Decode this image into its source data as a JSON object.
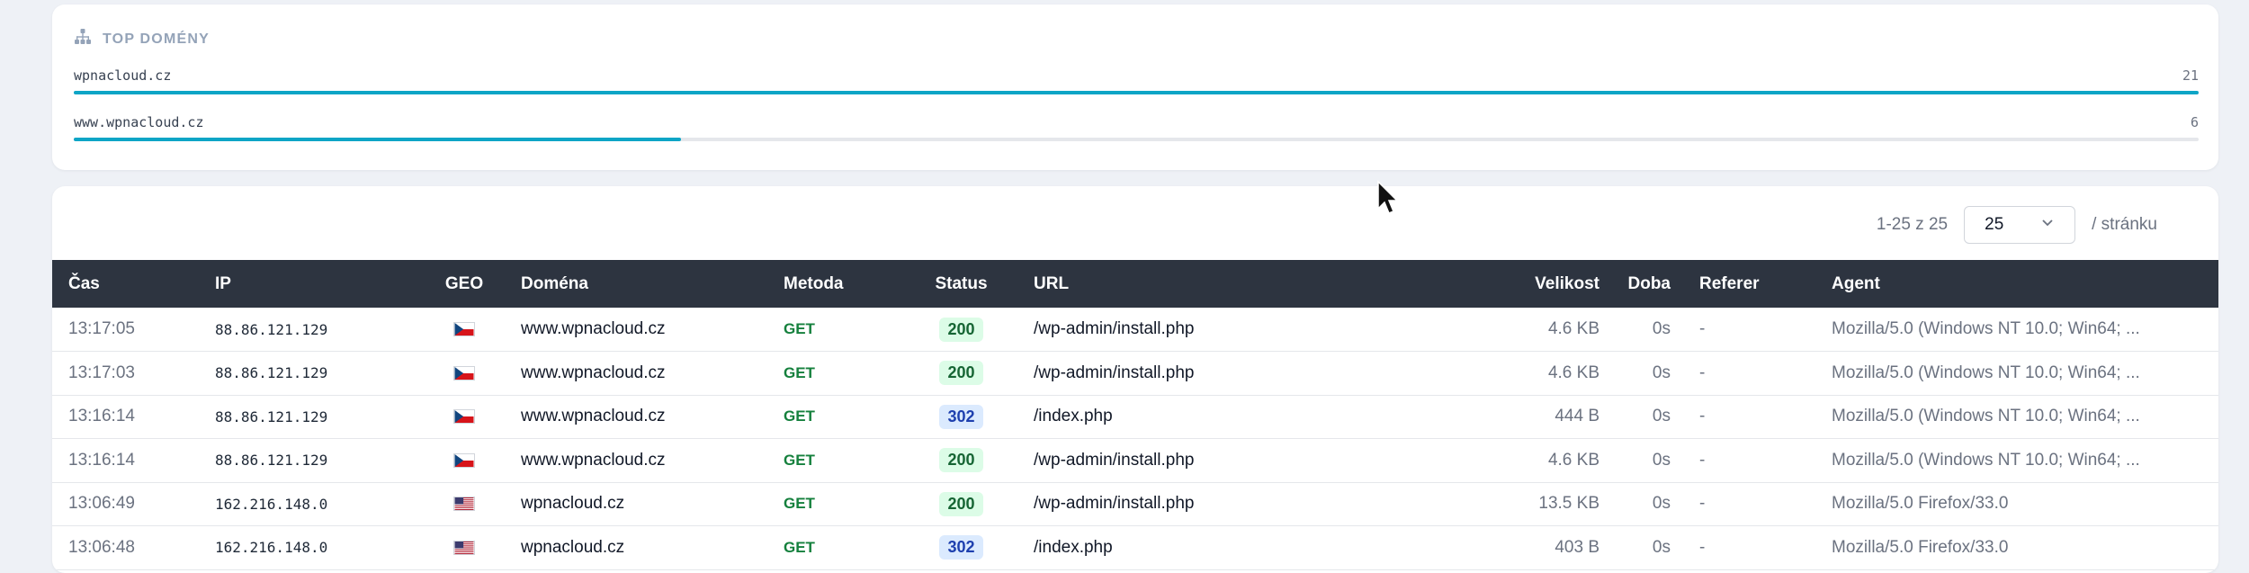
{
  "top_domains": {
    "title": "TOP DOMÉNY",
    "icon": "sitemap-icon",
    "bar_color": "#0ea5c6",
    "items": [
      {
        "domain": "wpnacloud.cz",
        "count": "21",
        "share": 1.0
      },
      {
        "domain": "www.wpnacloud.cz",
        "count": "6",
        "share": 0.2857
      }
    ]
  },
  "pagination": {
    "range": "1-25 z 25",
    "per_page": "25",
    "per_page_suffix": "/ stránku"
  },
  "table": {
    "columns": {
      "time": "Čas",
      "ip": "IP",
      "geo": "GEO",
      "domain": "Doména",
      "method": "Metoda",
      "status": "Status",
      "url": "URL",
      "size": "Velikost",
      "doba": "Doba",
      "referer": "Referer",
      "agent": "Agent"
    },
    "rows": [
      {
        "time": "13:17:05",
        "ip": "88.86.121.129",
        "geo": "CZ",
        "domain": "www.wpnacloud.cz",
        "method": "GET",
        "status": "200",
        "url": "/wp-admin/install.php",
        "size": "4.6 KB",
        "doba": "0s",
        "referer": "-",
        "agent": "Mozilla/5.0 (Windows NT 10.0; Win64; ..."
      },
      {
        "time": "13:17:03",
        "ip": "88.86.121.129",
        "geo": "CZ",
        "domain": "www.wpnacloud.cz",
        "method": "GET",
        "status": "200",
        "url": "/wp-admin/install.php",
        "size": "4.6 KB",
        "doba": "0s",
        "referer": "-",
        "agent": "Mozilla/5.0 (Windows NT 10.0; Win64; ..."
      },
      {
        "time": "13:16:14",
        "ip": "88.86.121.129",
        "geo": "CZ",
        "domain": "www.wpnacloud.cz",
        "method": "GET",
        "status": "302",
        "url": "/index.php",
        "size": "444 B",
        "doba": "0s",
        "referer": "-",
        "agent": "Mozilla/5.0 (Windows NT 10.0; Win64; ..."
      },
      {
        "time": "13:16:14",
        "ip": "88.86.121.129",
        "geo": "CZ",
        "domain": "www.wpnacloud.cz",
        "method": "GET",
        "status": "200",
        "url": "/wp-admin/install.php",
        "size": "4.6 KB",
        "doba": "0s",
        "referer": "-",
        "agent": "Mozilla/5.0 (Windows NT 10.0; Win64; ..."
      },
      {
        "time": "13:06:49",
        "ip": "162.216.148.0",
        "geo": "US",
        "domain": "wpnacloud.cz",
        "method": "GET",
        "status": "200",
        "url": "/wp-admin/install.php",
        "size": "13.5 KB",
        "doba": "0s",
        "referer": "-",
        "agent": "Mozilla/5.0 Firefox/33.0"
      },
      {
        "time": "13:06:48",
        "ip": "162.216.148.0",
        "geo": "US",
        "domain": "wpnacloud.cz",
        "method": "GET",
        "status": "302",
        "url": "/index.php",
        "size": "403 B",
        "doba": "0s",
        "referer": "-",
        "agent": "Mozilla/5.0 Firefox/33.0"
      }
    ]
  }
}
